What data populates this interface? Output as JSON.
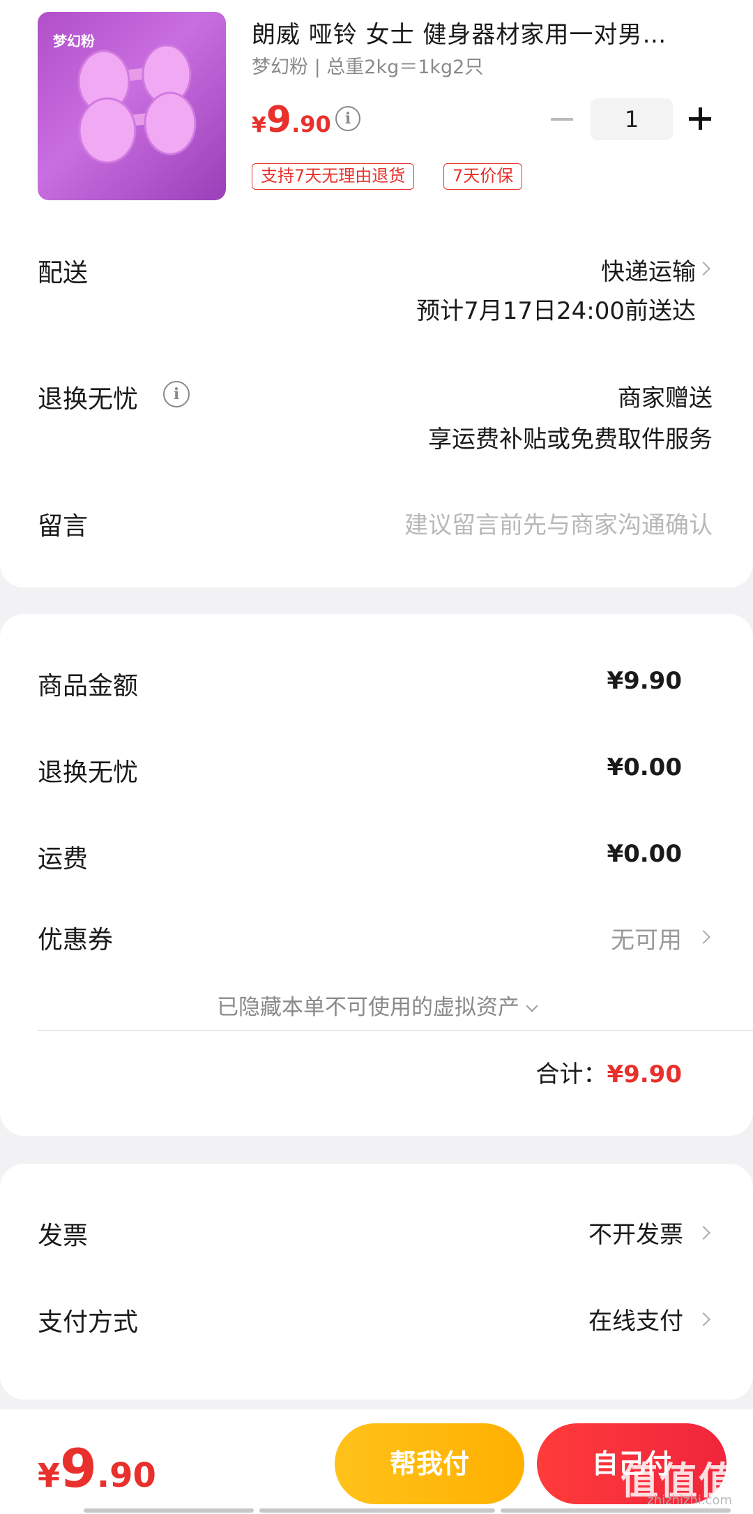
{
  "product": {
    "thumb_label": "梦幻粉",
    "title": "朗威 哑铃 女士 健身器材家用一对男…",
    "variant": "梦幻粉 | 总重2kg＝1kg2只",
    "price_currency": "¥",
    "price_int": "9",
    "price_dec": ".90",
    "quantity": "1",
    "tags": [
      "支持7天无理由退货",
      "7天价保"
    ]
  },
  "delivery": {
    "label": "配送",
    "method": "快递运输",
    "eta": "预计7月17日24:00前送达"
  },
  "returns": {
    "label": "退换无忧",
    "value": "商家赠送",
    "desc": "享运费补贴或免费取件服务"
  },
  "message": {
    "label": "留言",
    "placeholder": "建议留言前先与商家沟通确认"
  },
  "amounts": {
    "goods_label": "商品金额",
    "goods_value": "¥9.90",
    "returns_label": "退换无忧",
    "returns_value": "¥0.00",
    "shipping_label": "运费",
    "shipping_value": "¥0.00",
    "coupon_label": "优惠券",
    "coupon_value": "无可用",
    "hidden_assets": "已隐藏本单不可使用的虚拟资产",
    "total_label": "合计：",
    "total_value": "¥9.90"
  },
  "invoice": {
    "label": "发票",
    "value": "不开发票"
  },
  "payment": {
    "label": "支付方式",
    "value": "在线支付"
  },
  "bottom": {
    "price_currency": "¥",
    "price_int": "9",
    "price_dec": ".90",
    "help_pay": "帮我付",
    "self_pay": "自己付",
    "watermark": "值值值",
    "watermark_sub": "zhizhizhi.com"
  },
  "colors": {
    "accent": "#e8302c",
    "help_button": "#ffb000",
    "pay_button": "#f0253c"
  }
}
